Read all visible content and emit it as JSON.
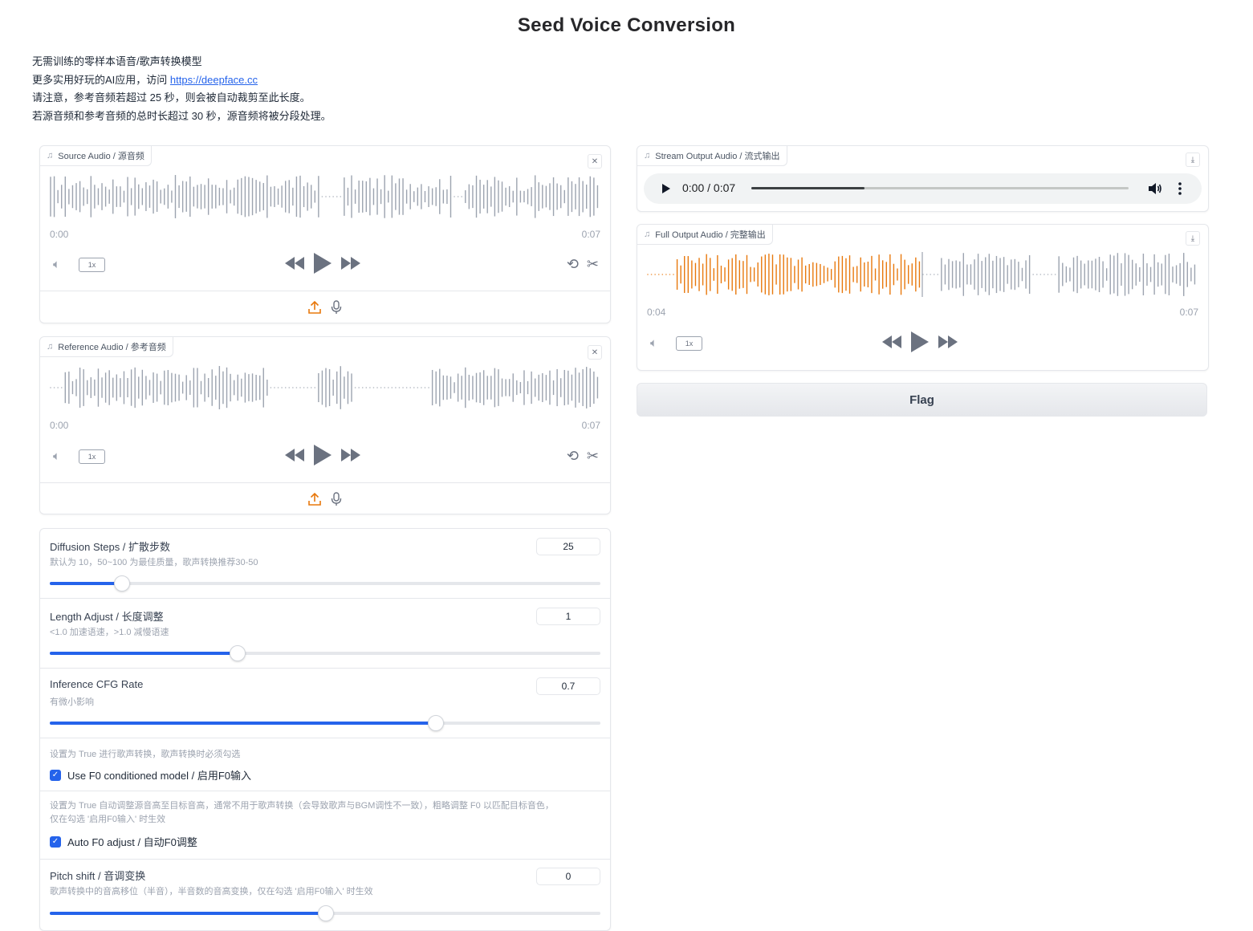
{
  "page": {
    "title": "Seed Voice Conversion",
    "description": {
      "line1": "无需训练的零样本语音/歌声转换模型",
      "line2_prefix": "更多实用好玩的AI应用，访问 ",
      "line2_link": "https://deepface.cc",
      "line3": "请注意，参考音频若超过 25 秒，则会被自动裁剪至此长度。",
      "line4": "若源音频和参考音频的总时长超过 30 秒，源音频将被分段处理。"
    }
  },
  "source_audio": {
    "label": "Source Audio / 源音频",
    "time_start": "0:00",
    "time_end": "0:07",
    "speed": "1x"
  },
  "reference_audio": {
    "label": "Reference Audio / 参考音频",
    "time_start": "0:00",
    "time_end": "0:07",
    "speed": "1x"
  },
  "sliders": {
    "diffusion": {
      "label": "Diffusion Steps / 扩散步数",
      "info": "默认为 10，50~100 为最佳质量，歌声转换推荐30-50",
      "value": "25",
      "fraction": 0.13
    },
    "length": {
      "label": "Length Adjust / 长度调整",
      "info": "<1.0 加速语速，>1.0 减慢语速",
      "value": "1",
      "fraction": 0.34
    },
    "cfg": {
      "label": "Inference CFG Rate",
      "info": "有微小影响",
      "value": "0.7",
      "fraction": 0.7
    },
    "pitch": {
      "label": "Pitch shift / 音调变换",
      "info": "歌声转换中的音高移位（半音），半音数的音高变换，仅在勾选 '启用F0输入' 时生效",
      "value": "0",
      "fraction": 0.5
    }
  },
  "checkboxes": {
    "f0_condition": {
      "info": "设置为 True 进行歌声转换，歌声转换时必须勾选",
      "label": "Use F0 conditioned model / 启用F0输入",
      "checked": true
    },
    "auto_f0": {
      "info_line1": "设置为 True 自动调整源音高至目标音高，通常不用于歌声转换（会导致歌声与BGM调性不一致），粗略调整 F0 以匹配目标音色，",
      "info_line2": "仅在勾选 '启用F0输入' 时生效",
      "label": "Auto F0 adjust / 自动F0调整",
      "checked": true
    }
  },
  "stream_output": {
    "label": "Stream Output Audio / 流式输出",
    "time_display": "0:00 / 0:07",
    "progress": 0.3
  },
  "full_output": {
    "label": "Full Output Audio / 完整输出",
    "time_start": "0:04",
    "time_end": "0:07",
    "speed": "1x",
    "progress": 0.5
  },
  "flag": {
    "label": "Flag"
  },
  "colors": {
    "accent": "#2563eb",
    "waveform": "#9ca3af",
    "waveform_played": "#e8780c",
    "upload_icon": "#e8780c"
  }
}
